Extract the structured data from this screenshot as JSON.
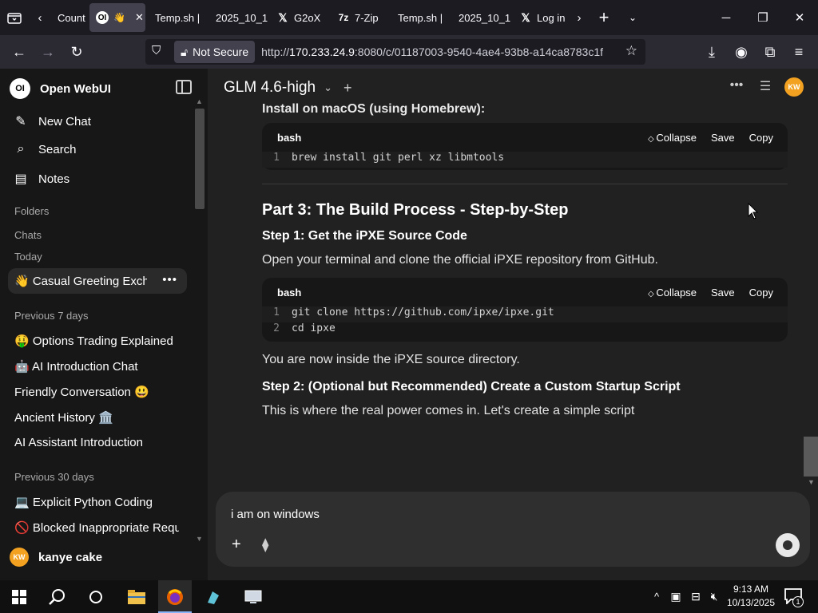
{
  "browser": {
    "tabs": [
      {
        "label": "Count",
        "icon": "none"
      },
      {
        "label": "",
        "icon": "openwebui",
        "emoji": "👋",
        "active": true
      },
      {
        "label": "Temp.sh |",
        "icon": "none"
      },
      {
        "label": "2025_10_1",
        "icon": "none"
      },
      {
        "label": "G2oX",
        "icon": "x"
      },
      {
        "label": "7-Zip",
        "icon": "7zip"
      },
      {
        "label": "Temp.sh |",
        "icon": "none"
      },
      {
        "label": "2025_10_1",
        "icon": "none"
      },
      {
        "label": "Log in",
        "icon": "x"
      }
    ],
    "security_label": "Not Secure",
    "url_prefix": "http://",
    "url_host": "170.233.24.9",
    "url_rest": ":8080/c/01187003-9540-4ae4-93b8-a14ca8783c1f"
  },
  "sidebar": {
    "app_title": "Open WebUI",
    "logo_text": "OI",
    "nav": [
      {
        "label": "New Chat",
        "icon": "pencil-icon"
      },
      {
        "label": "Search",
        "icon": "search-icon"
      },
      {
        "label": "Notes",
        "icon": "note-icon"
      }
    ],
    "folders_label": "Folders",
    "chats_label": "Chats",
    "today_label": "Today",
    "today_chats": [
      "👋 Casual Greeting Exchange"
    ],
    "prev7_label": "Previous 7 days",
    "prev7_chats": [
      "🤑 Options Trading Explained",
      "🤖 AI Introduction Chat",
      "Friendly Conversation 😃",
      "Ancient History 🏛️",
      "AI Assistant Introduction"
    ],
    "prev30_label": "Previous 30 days",
    "prev30_chats": [
      "💻 Explicit Python Coding",
      "🚫 Blocked Inappropriate Request"
    ],
    "user_name": "kanye cake",
    "user_initials": "KW"
  },
  "main": {
    "model_name": "GLM 4.6-high",
    "avatar_initials": "KW",
    "install_heading": "Install on macOS (using Homebrew):",
    "codeblock1": {
      "lang": "bash",
      "collapse": "Collapse",
      "save": "Save",
      "copy": "Copy",
      "lines": [
        {
          "n": "1",
          "code": "brew install git perl xz libmtools"
        }
      ]
    },
    "part3_heading": "Part 3: The Build Process - Step-by-Step",
    "step1_heading": "Step 1: Get the iPXE Source Code",
    "step1_text": "Open your terminal and clone the official iPXE repository from GitHub.",
    "codeblock2": {
      "lang": "bash",
      "collapse": "Collapse",
      "save": "Save",
      "copy": "Copy",
      "lines": [
        {
          "n": "1",
          "code": "git clone https://github.com/ipxe/ipxe.git"
        },
        {
          "n": "2",
          "code": "cd ipxe"
        }
      ]
    },
    "after_code_text": "You are now inside the iPXE source directory.",
    "step2_heading": "Step 2: (Optional but Recommended) Create a Custom Startup Script",
    "step2_text": "This is where the real power comes in. Let's create a simple script",
    "input_value": "i am on windows"
  },
  "taskbar": {
    "time": "9:13 AM",
    "date": "10/13/2025",
    "notification_count": "1"
  },
  "colors": {
    "accent_avatar": "#f2a120",
    "sidebar_bg": "#171717",
    "main_bg": "#212121",
    "code_bg": "#171717"
  }
}
